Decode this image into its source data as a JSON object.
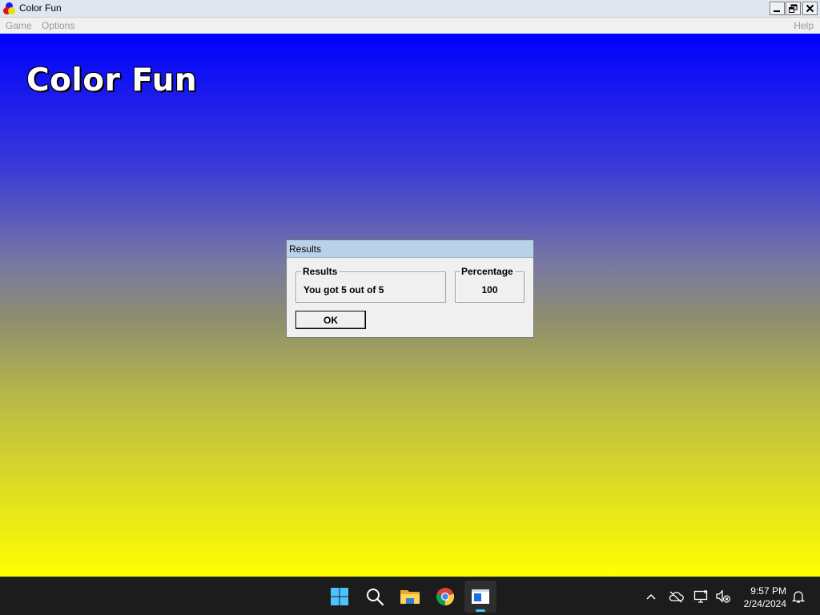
{
  "window": {
    "title": "Color Fun",
    "controls": {
      "minimize": "_",
      "restore": "❐",
      "close": "✕"
    }
  },
  "menubar": {
    "items": [
      "Game",
      "Options"
    ],
    "help": "Help"
  },
  "canvas": {
    "game_title": "Color Fun",
    "gradient_top": "#0000ff",
    "gradient_bottom": "#ffff00"
  },
  "dialog": {
    "title": "Results",
    "results_group": {
      "label": "Results",
      "value": "You got 5 out of 5"
    },
    "percentage_group": {
      "label": "Percentage",
      "value": "100"
    },
    "ok_label": "OK"
  },
  "taskbar": {
    "icons": [
      "windows-start-icon",
      "search-icon",
      "file-explorer-icon",
      "chrome-icon",
      "color-fun-app-icon"
    ],
    "tray_icons": [
      "chevron-up-icon",
      "cloud-offline-icon",
      "network-icon",
      "volume-muted-icon",
      "notification-bell-icon"
    ],
    "clock": {
      "time": "9:57 PM",
      "date": "2/24/2024"
    }
  }
}
